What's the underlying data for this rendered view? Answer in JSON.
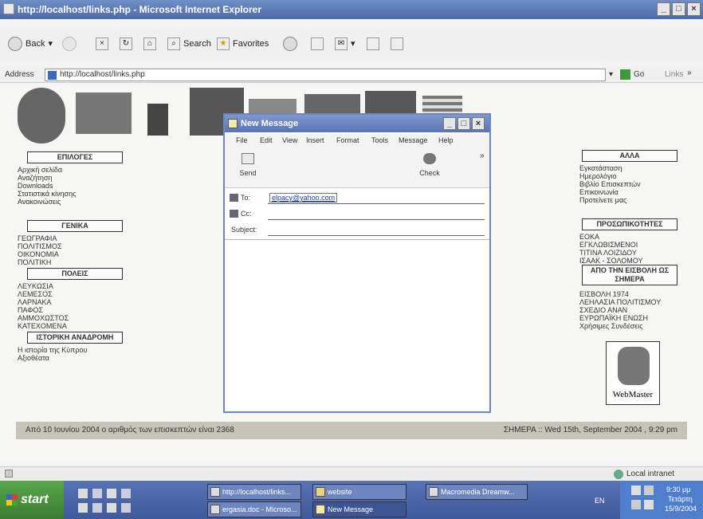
{
  "window": {
    "title": "http://localhost/links.php - Microsoft Internet Explorer"
  },
  "toolbar": {
    "back": "Back",
    "search": "Search",
    "favorites": "Favorites"
  },
  "address": {
    "label": "Address",
    "value": "http://localhost/links.php",
    "go": "Go",
    "links": "Links"
  },
  "left_menu": {
    "epiloges": {
      "title": "ΕΠΙΛΟΓΕΣ",
      "items": [
        "Αρχική σελίδα",
        "Αναζήτηση",
        "Downloads",
        "Στατιστικά κίνησης",
        "Ανακοινώσεις"
      ]
    },
    "genika": {
      "title": "ΓΕΝΙΚΑ",
      "items": [
        "ΓΕΩΓΡΑΦΙΑ",
        "ΠΟΛΙΤΙΣΜΟΣ",
        "ΟΙΚΟΝΟΜΙΑ",
        "ΠΟΛΙΤΙΚΗ"
      ]
    },
    "poleis": {
      "title": "ΠΟΛΕΙΣ",
      "items": [
        "ΛΕΥΚΩΣΙΑ",
        "ΛΕΜΕΣΟΣ",
        "ΛΑΡΝΑΚΑ",
        "ΠΑΦΟΣ",
        "ΑΜΜΟΧΩΣΤΟΣ",
        "ΚΑΤΕΧΟΜΕΝΑ"
      ]
    },
    "istoriki": {
      "title": "ΙΣΤΟΡΙΚΗ ΑΝΑΔΡΟΜΗ",
      "items": [
        "Η ιστορία της Κύπρου",
        "Αξιοθέατα"
      ]
    }
  },
  "right_menu": {
    "alla": {
      "title": "ΑΛΛΑ",
      "items": [
        "Εγκατάσταση",
        "Ημερολόγιο",
        "Βιβλίο Επισκεπτών",
        "Επικοινωνία",
        "Προτείνετε μας"
      ]
    },
    "prosopikotites": {
      "title": "ΠΡΟΣΩΠΙΚΟΤΗΤΕΣ",
      "items": [
        "ΕΟΚΑ",
        "ΕΓΚΛΩΒΙΣΜΕΝΟΙ",
        "ΤΙΤΙΝΑ ΛΟΙΖΙΔΟΥ",
        "ΙΣΑΑΚ - ΣΟΛΟΜΟΥ"
      ]
    },
    "eisvoli": {
      "title": "ΑΠΟ ΤΗΝ ΕΙΣΒΟΛΗ ΩΣ ΣΗΜΕΡΑ",
      "items": [
        "ΕΙΣΒΟΛΗ 1974",
        "ΛΕΗΛΑΣΙΑ ΠΟΛΙΤΙΣΜΟΥ",
        "ΣΧΕΔΙΟ ΑΝΑΝ",
        "ΕΥΡΩΠΑΪΚΗ ΕΝΩΣΗ",
        "Χρήσιμες Συνδέσεις"
      ]
    },
    "webmaster": "WebMaster"
  },
  "footer": {
    "left": "Από 10 Ιουνίου 2004 ο αριθμός των επισκεπτών είναι 2368",
    "right": "ΣΗΜΕΡΑ :: Wed 15th, September 2004 , 9:29 pm"
  },
  "status": {
    "zone": "Local intranet"
  },
  "dialog": {
    "title": "New Message",
    "menu": [
      "File",
      "Edit",
      "View",
      "Insert",
      "Format",
      "Tools",
      "Message",
      "Help"
    ],
    "send": "Send",
    "check": "Check",
    "to_label": "To:",
    "to_value": "elpacy@yahoo.com",
    "cc_label": "Cc:",
    "subject_label": "Subject:"
  },
  "taskbar": {
    "start": "start",
    "tasks": [
      "http://localhost/links...",
      "website",
      "Macromedia Dreamw...",
      "ergasia.doc - Microso...",
      "New Message"
    ],
    "lang": "EN",
    "clock": "9:30 μμ",
    "day": "Τετάρτη",
    "date": "15/9/2004"
  },
  "colors": {
    "title_bar": "#5873b5",
    "footer_bar": "#c6c3b8",
    "start": "#3b7c31"
  }
}
